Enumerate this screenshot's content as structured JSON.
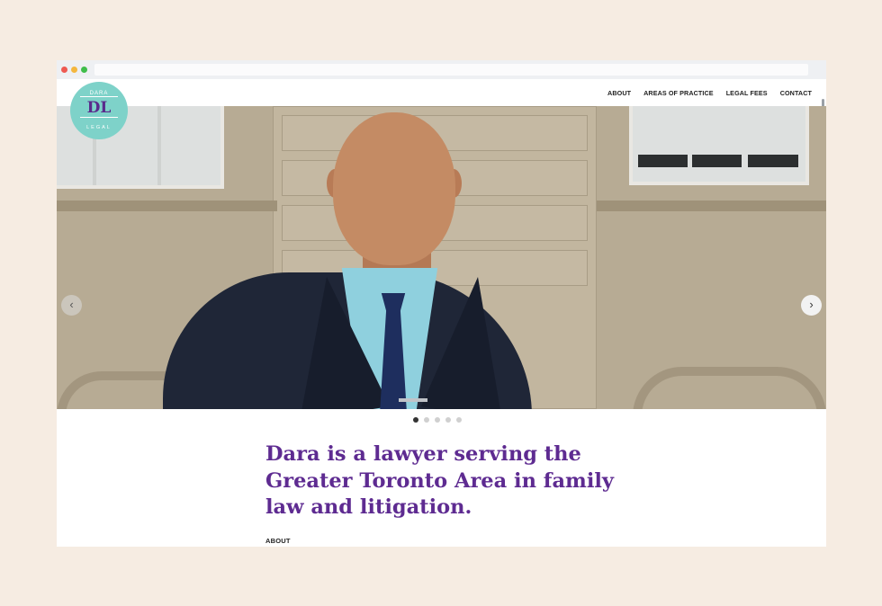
{
  "logo": {
    "top_text": "DARA",
    "monogram": "DL",
    "bottom_text": "LEGAL"
  },
  "nav": {
    "items": [
      "ABOUT",
      "AREAS OF PRACTICE",
      "LEGAL FEES",
      "CONTACT"
    ]
  },
  "carousel": {
    "prev_icon": "chevron-left-icon",
    "next_icon": "chevron-right-icon",
    "prev_glyph": "‹",
    "next_glyph": "›",
    "slide_count": 5,
    "active_index": 0
  },
  "main": {
    "headline": "Dara is a lawyer serving the Greater Toronto Area in family law and litigation.",
    "section_label": "ABOUT"
  },
  "colors": {
    "background": "#f6ece2",
    "logo_circle": "#7ed2c9",
    "headline": "#5e2b91"
  }
}
